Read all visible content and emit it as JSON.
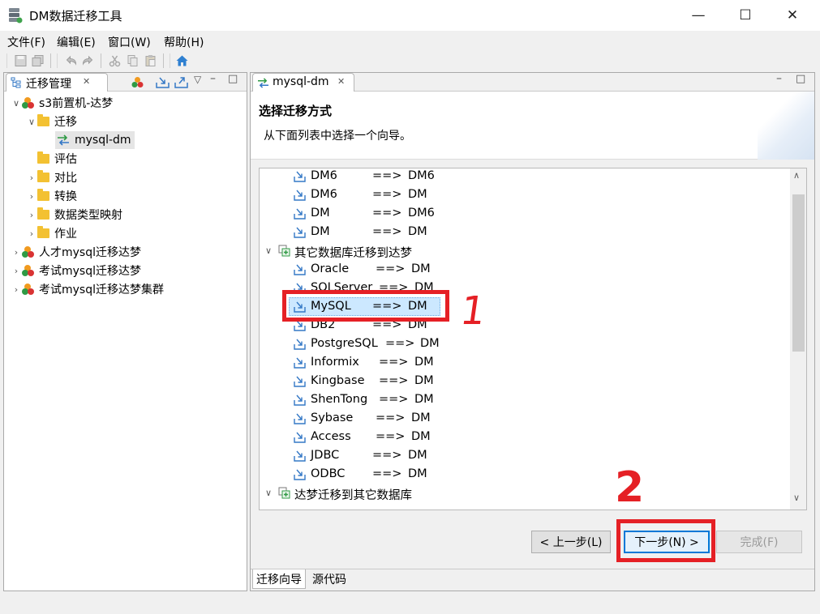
{
  "window": {
    "title": "DM数据迁移工具",
    "minimize_glyph": "—",
    "maximize_glyph": "☐",
    "close_glyph": "✕"
  },
  "menu": [
    "文件(F)",
    "编辑(E)",
    "窗口(W)",
    "帮助(H)"
  ],
  "toolbar": {
    "icons": [
      "save-icon",
      "save-all-icon",
      "undo-icon",
      "redo-icon",
      "cut-icon",
      "copy-icon",
      "paste-icon",
      "home-icon"
    ]
  },
  "left_panel": {
    "tab_label": "迁移管理",
    "tree": [
      {
        "label": "s3前置机-达梦",
        "level": 0,
        "expanded": true,
        "icon": "project-icon"
      },
      {
        "label": "迁移",
        "level": 1,
        "expanded": true,
        "icon": "folder-open-icon"
      },
      {
        "label": "mysql-dm",
        "level": 2,
        "icon": "migration-icon",
        "selected": true
      },
      {
        "label": "评估",
        "level": 1,
        "icon": "folder-icon"
      },
      {
        "label": "对比",
        "level": 1,
        "expanded": false,
        "icon": "folder-icon"
      },
      {
        "label": "转换",
        "level": 1,
        "expanded": false,
        "icon": "folder-icon"
      },
      {
        "label": "数据类型映射",
        "level": 1,
        "expanded": false,
        "icon": "folder-icon"
      },
      {
        "label": "作业",
        "level": 1,
        "expanded": false,
        "icon": "folder-icon"
      },
      {
        "label": "人才mysql迁移达梦",
        "level": 0,
        "expanded": false,
        "icon": "project-icon"
      },
      {
        "label": "考试mysql迁移达梦",
        "level": 0,
        "expanded": false,
        "icon": "project-icon"
      },
      {
        "label": "考试mysql迁移达梦集群",
        "level": 0,
        "expanded": false,
        "icon": "project-icon"
      }
    ]
  },
  "right_panel": {
    "tab_label": "mysql-dm",
    "wizard_title": "选择迁移方式",
    "wizard_desc": "从下面列表中选择一个向导。",
    "list": [
      {
        "type": "item",
        "source": "DM6",
        "arrow": "==>",
        "target": "DM6"
      },
      {
        "type": "item",
        "source": "DM6",
        "arrow": "==>",
        "target": "DM"
      },
      {
        "type": "item",
        "source": "DM",
        "arrow": "==>",
        "target": "DM6"
      },
      {
        "type": "item",
        "source": "DM",
        "arrow": "==>",
        "target": "DM"
      },
      {
        "type": "category",
        "label": "其它数据库迁移到达梦"
      },
      {
        "type": "item",
        "source": "Oracle",
        "arrow": "==>",
        "target": "DM"
      },
      {
        "type": "item",
        "source": "SQLServer",
        "arrow": "==>",
        "target": "DM"
      },
      {
        "type": "item",
        "source": "MySQL",
        "arrow": "==>",
        "target": "DM",
        "selected": true
      },
      {
        "type": "item",
        "source": "DB2",
        "arrow": "==>",
        "target": "DM"
      },
      {
        "type": "item",
        "source": "PostgreSQL",
        "arrow": "==>",
        "target": "DM"
      },
      {
        "type": "item",
        "source": "Informix",
        "arrow": "==>",
        "target": "DM"
      },
      {
        "type": "item",
        "source": "Kingbase",
        "arrow": "==>",
        "target": "DM"
      },
      {
        "type": "item",
        "source": "ShenTong",
        "arrow": "==>",
        "target": "DM"
      },
      {
        "type": "item",
        "source": "Sybase",
        "arrow": "==>",
        "target": "DM"
      },
      {
        "type": "item",
        "source": "Access",
        "arrow": "==>",
        "target": "DM"
      },
      {
        "type": "item",
        "source": "JDBC",
        "arrow": "==>",
        "target": "DM"
      },
      {
        "type": "item",
        "source": "ODBC",
        "arrow": "==>",
        "target": "DM"
      },
      {
        "type": "category",
        "label": "达梦迁移到其它数据库"
      }
    ],
    "buttons": {
      "back": "< 上一步(L)",
      "next": "下一步(N) >",
      "finish": "完成(F)"
    },
    "bottom_tabs": [
      "迁移向导",
      "源代码"
    ]
  },
  "annotations": {
    "mark_1": "1",
    "mark_2": "2",
    "color": "#e52025"
  },
  "colors": {
    "selection": "#cce8ff",
    "tree_selection": "#e5e5e5",
    "accent": "#0078d7"
  }
}
